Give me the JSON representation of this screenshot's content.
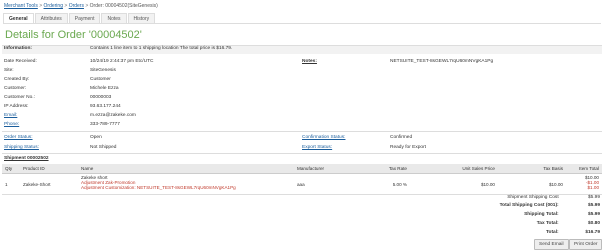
{
  "breadcrumbs": [
    "Merchant Tools",
    "Ordering",
    "Orders",
    "Order: 00004502(SiteGenesis)"
  ],
  "tabs": [
    "General",
    "Attributes",
    "Payment",
    "Notes",
    "History"
  ],
  "title": "Details for Order '00004502'",
  "info": {
    "information_label": "Information:",
    "information_value": "Contains 1 line item to 1 shipping location The total price is $16.79.",
    "date_label": "Date Received:",
    "date_value": "10/24/19 2:44:37 pm Etc/UTC",
    "notes_label": "Notes:",
    "notes_value": "NETSUITE_TEST-8sGEWL7rqU60mNVgKA1Pg",
    "site_label": "Site:",
    "site_value": "SiteGenesis",
    "created_label": "Created By:",
    "created_value": "Customer",
    "customer_label": "Customer:",
    "customer_value": "Michele Ezza",
    "customerno_label": "Customer No.:",
    "customerno_value": "00000003",
    "ip_label": "IP Address:",
    "ip_value": "93.63.177.244",
    "email_label": "Email:",
    "email_value": "m.ezza@zakeke.com",
    "phone_label": "Phone:",
    "phone_value": "333-789-7777"
  },
  "status": {
    "order_label": "Order Status:",
    "order_value": "Open",
    "confirm_label": "Confirmation Status:",
    "confirm_value": "Confirmed",
    "shipping_label": "Shipping Status:",
    "shipping_value": "Not Shipped",
    "export_label": "Export Status:",
    "export_value": "Ready for Export"
  },
  "shipment": {
    "link": "Shipment 00002502",
    "headers": [
      "Qty",
      "Product ID",
      "Name",
      "Manufacturer",
      "Tax Rate",
      "Unit Sales Price",
      "Tax Basis",
      "Item Total"
    ],
    "row": {
      "qty": "1",
      "product_id": "Zakeke-Short",
      "name": "Zakeke short",
      "adj1": "Adjustment Zak-Promotion",
      "adj2": "Adjustment Customization: NETSUITE_TEST-8sGEWL7rqU60mNVgKA1Pg",
      "manufacturer": "aaa",
      "tax_rate": "5.00 %",
      "unit_price": "$10.00",
      "tax_basis": "$10.00",
      "total": "$10.00",
      "total_adj1": "-$1.00",
      "total_adj2": "$1.00"
    }
  },
  "totals": [
    {
      "label": "Shipment Shipping Cost",
      "value": "$5.99"
    },
    {
      "label": "Total Shipping Cost (001):",
      "value": "$5.99"
    },
    {
      "label": "Shipping Total:",
      "value": "$5.99"
    },
    {
      "label": "Tax Total:",
      "value": "$0.80"
    },
    {
      "label": "Total:",
      "value": "$16.79"
    }
  ],
  "buttons": {
    "send_email": "Send Email",
    "print_order": "Print Order"
  }
}
